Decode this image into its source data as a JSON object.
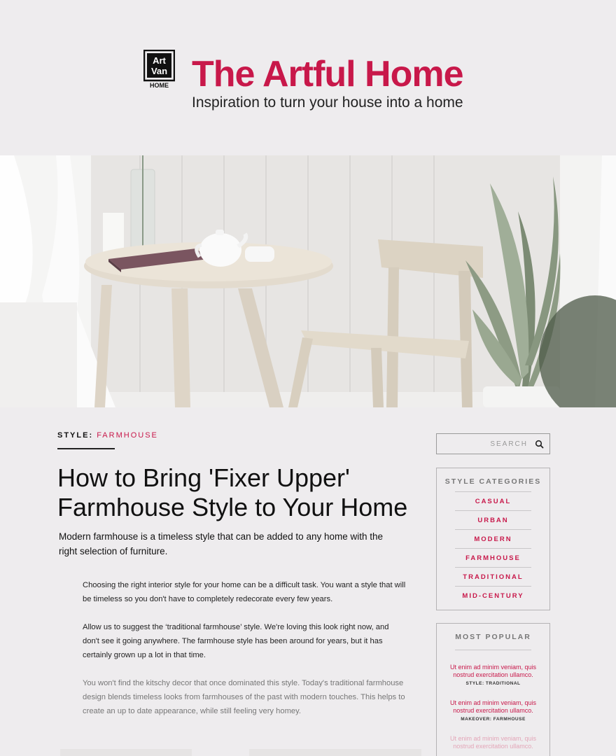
{
  "header": {
    "logo_text_line1": "Art",
    "logo_text_line2": "Van",
    "logo_text_line3": "HOME",
    "title": "The Artful Home",
    "tagline": "Inspiration to turn your house into a home"
  },
  "hero": {
    "image_icon": "dining-room-photo"
  },
  "article": {
    "category_key": "STYLE:",
    "category_value": "FARMHOUSE",
    "title": "How to Bring 'Fixer Upper' Farmhouse Style to Your Home",
    "lede": "Modern farmhouse is a timeless style that can be added to any home with the right selection of furniture.",
    "paragraphs": [
      "Choosing the right interior style for your home can be a difficult task. You want a style that will be timeless so you don't have to completely redecorate every few years.",
      "Allow us to suggest the ‘traditional farmhouse’ style. We're loving this look right now, and don't see it going anywhere. The farmhouse style has been around for years, but it has certainly grown up a lot in that time.",
      "You won't find the kitschy decor that once dominated this style. Today's traditional farmhouse design blends timeless looks from farmhouses of the past with modern touches. This helps to create an up to date appearance, while still feeling very homey."
    ]
  },
  "sidebar": {
    "search_placeholder": "SEARCH",
    "search_icon": "search-icon",
    "categories_title": "STYLE CATEGORIES",
    "categories": [
      "CASUAL",
      "URBAN",
      "MODERN",
      "FARMHOUSE",
      "TRADITIONAL",
      "MID-CENTURY"
    ],
    "popular_title": "MOST POPULAR",
    "popular": [
      {
        "text": "Ut enim ad minim veniam, quis nostrud exercitation ullamco.",
        "tag": "STYLE: TRADITIONAL"
      },
      {
        "text": "Ut enim ad minim veniam, quis nostrud exercitation ullamco.",
        "tag": "MAKEOVER: FARMHOUSE"
      },
      {
        "text": "Ut enim ad minim veniam, quis nostrud exercitation ullamco.",
        "tag": ""
      }
    ]
  },
  "colors": {
    "accent": "#c8184a",
    "background": "#eeecee",
    "text": "#1a1a1a"
  }
}
